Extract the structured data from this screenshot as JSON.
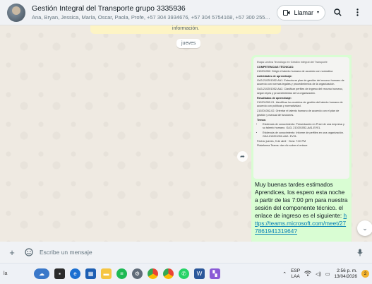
{
  "header": {
    "title": "Gestión Integral del Transporte grupo 3335936",
    "members": "Ana, Bryan, Jessica, María, Oscar, Paola, Profe, +57 304 3934676, +57 304 5754168, +57 300 25551...",
    "call_label": "Llamar",
    "search_icon": "search-icon",
    "menu_icon": "kebab-menu-icon"
  },
  "chat": {
    "system_message": "información.",
    "date_divider": "jueves",
    "document": {
      "heading": "Etapa Lectiva Tecnólogo en Gestión Integral del Transporte",
      "section1": "COMPETENCIAS TÉCNICAS:",
      "p1": "210201052: Dirigir el talento humano de acuerdo con normativa",
      "section2": "Actividades de aprendizaje:",
      "p2": "GA3-210201052-AA1. Estructurar plan de gestión del recurso humano de acuerdo con normas legales y procedimientos de la organización.",
      "p3": "GA3-210201052-AA2. Clasificar perfiles de ingreso del recurso humano, según leyes y procedimientos de la organización.",
      "section3": "Resultados de aprendizaje:",
      "p4": "210201052-01. Identificar los modelos de gestión del talento humano de acuerdo con políticas y normatividad.",
      "p5": "210201052-02. Orientar el talento humano de acuerdo con el plan de gestión y manual de funciones.",
      "section4": "Temas:",
      "li1": "Evidencia de conocimiento: Presentación en Prezi de una empresa y su talento humano. GA3- 210201052-AA1-EV01.",
      "li2": "Evidencia de conocimiento: Informe de perfiles en una organización. GA3-210201052-AA2- EV01.",
      "date_line": "Fecha: jueves, 9 de abril · Hora: 7:00 PM",
      "platform_line": "Plataforma Teams: dar clic sobre el enlace"
    },
    "message_text": "Muy buenas tardes estimados Aprendices, los espero esta noche a partir de las 7:00 pm para nuestra sesión del componente técnico. el enlace de ingreso es el siguiente: ",
    "message_link": "https://teams.microsoft.com/meet/27786194131964?"
  },
  "composer": {
    "placeholder": "Escribe un mensaje"
  },
  "taskbar": {
    "left_label": "la",
    "apps": [
      "widgets-icon",
      "task-view-icon",
      "edge-icon",
      "store-icon",
      "file-explorer-icon",
      "spotify-icon",
      "settings-icon",
      "chrome-icon",
      "chrome-profile-icon",
      "whatsapp-icon",
      "word-icon",
      "code-icon"
    ],
    "lang_top": "ESP",
    "lang_bottom": "LAA",
    "time": "2:56 p. m.",
    "date": "13/04/2026",
    "notifications": "2"
  },
  "colors": {
    "bubble_out": "#d9fdd3",
    "chat_bg": "#efeae2",
    "link": "#027eb5",
    "panel": "#f0f2f5"
  }
}
